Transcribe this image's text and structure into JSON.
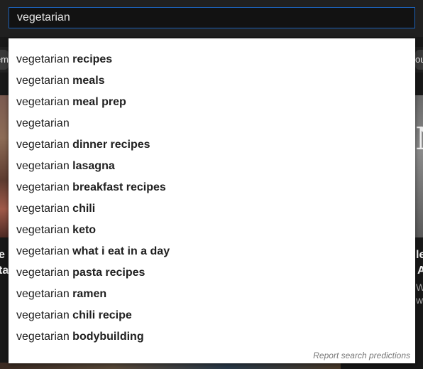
{
  "search": {
    "query": "vegetarian"
  },
  "chips": {
    "left_text": "em",
    "right_text": "ou"
  },
  "background": {
    "left_title_1": "e",
    "left_title_2": "ta",
    "right_title_1": "le",
    "right_title_2": "A",
    "right_sub_1": "W",
    "right_sub_2": "ws",
    "right_glyph": "N"
  },
  "suggestions": [
    {
      "prefix": "vegetarian",
      "completion": " recipes"
    },
    {
      "prefix": "vegetarian",
      "completion": " meals"
    },
    {
      "prefix": "vegetarian",
      "completion": " meal prep"
    },
    {
      "prefix": "vegetarian",
      "completion": ""
    },
    {
      "prefix": "vegetarian",
      "completion": " dinner recipes"
    },
    {
      "prefix": "vegetarian",
      "completion": " lasagna"
    },
    {
      "prefix": "vegetarian",
      "completion": " breakfast recipes"
    },
    {
      "prefix": "vegetarian",
      "completion": " chili"
    },
    {
      "prefix": "vegetarian",
      "completion": " keto"
    },
    {
      "prefix": "vegetarian",
      "completion": " what i eat in a day"
    },
    {
      "prefix": "vegetarian",
      "completion": " pasta recipes"
    },
    {
      "prefix": "vegetarian",
      "completion": " ramen"
    },
    {
      "prefix": "vegetarian",
      "completion": " chili recipe"
    },
    {
      "prefix": "vegetarian",
      "completion": " bodybuilding"
    }
  ],
  "report_link": "Report search predictions",
  "colors": {
    "focus_border": "#1c62b9",
    "background": "#181818",
    "dropdown": "#ffffff"
  }
}
